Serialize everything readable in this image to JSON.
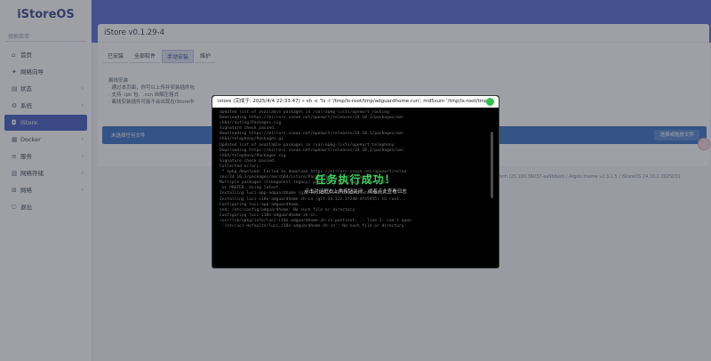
{
  "app": {
    "logo": "iStoreOS",
    "search_placeholder": "搜索菜单"
  },
  "sidebar": {
    "items": [
      {
        "label": "首页",
        "icon": "home-icon",
        "has_arrow": false,
        "active": false
      },
      {
        "label": "网络向导",
        "icon": "wizard-icon",
        "has_arrow": false,
        "active": false
      },
      {
        "label": "状态",
        "icon": "status-icon",
        "has_arrow": true,
        "active": false
      },
      {
        "label": "系统",
        "icon": "system-icon",
        "has_arrow": true,
        "active": false
      },
      {
        "label": "iStore",
        "icon": "store-icon",
        "has_arrow": false,
        "active": true
      },
      {
        "label": "Docker",
        "icon": "docker-icon",
        "has_arrow": true,
        "active": false
      },
      {
        "label": "服务",
        "icon": "services-icon",
        "has_arrow": true,
        "active": false
      },
      {
        "label": "网络存储",
        "icon": "storage-icon",
        "has_arrow": true,
        "active": false
      },
      {
        "label": "网络",
        "icon": "network-icon",
        "has_arrow": true,
        "active": false
      },
      {
        "label": "退出",
        "icon": "logout-icon",
        "has_arrow": false,
        "active": false
      }
    ]
  },
  "main": {
    "title": "iStore v0.1.29-4",
    "tabs": [
      {
        "label": "已安装",
        "active": false
      },
      {
        "label": "全部软件",
        "active": false
      },
      {
        "label": "手动安装",
        "active": true
      },
      {
        "label": "维护",
        "active": false
      }
    ],
    "notes": [
      "离线安装",
      "· 通过本页面，你可以上传并安装插件包",
      "· 支持 .ipk 包、.run 自解压格式",
      "· 离线安装插件可能不会出现在iStore中"
    ],
    "upload_label": "未选择任何文件",
    "upload_button": "选择或拖放文件",
    "footer_note": "ov-24.10 branch (25.100.36037-aa9b6ed) / Argon theme v2.3.1.5 / iStoreOS 24.10.1 2025031"
  },
  "terminal": {
    "header": "istore (完成于:  2025/4/4 22:33:47) » sh -c \"ls -l '/tmp/ls-root/tmp/adguardhome.run'; md5sum '/tmp/ls-root/tmp...",
    "log_lines": [
      "Updated list of available packages in /var/opkg-lists/openwrt_routing",
      "Downloading https://mirrors.vsean.net/openwrt/releases/24.10.1/packages/aar",
      "ch64/routing/Packages.sig",
      "Signature check passed.",
      "Downloading https://mirrors.vsean.net/openwrt/releases/24.10.1/packages/aar",
      "ch64/telephony/Packages.gz",
      "Updated list of available packages in /var/opkg-lists/openwrt_telephony",
      "Downloading https://mirrors.vsean.net/openwrt/releases/24.10.1/packages/aar",
      "ch64/telephony/Packages.sig",
      "Signature check passed.",
      "Collected errors:",
      " * opkg_download: Failed to download https://mirrors.vsean.net/openwrt/relea",
      "ses/24.10.1/packages/aarch64/istore/Packages.gz, wget returned 8.",
      "Multiple packages (libopenssl-legacy) providing same name marked HOLD",
      " or PREFER. Using latest.",
      "Installing luci-app-adguardhome (git-24.122.27248-4fe5955) to root...",
      "Installing luci-i18n-adguardhome-zh-cn (git-24.122.27248-4fe5955) to root...",
      "Configuring luci-app-adguardhome.",
      "sed: /etc/config/adguardhome: No such file or directory",
      "Configuring luci-i18n-adguardhome-zh-cn.",
      "/usr/lib/opkg/info/luci-i18n-adguardhome-zh-cn.postinst: .: line 2: can't open",
      " '/etc/uci-defaults/luci-i18n-adguardhome-zh-cn': No such file or directory"
    ],
    "success_text": "任务执行成功！",
    "subtip": "点击对话框右上角按钮关闭，或者点此查看日志"
  }
}
